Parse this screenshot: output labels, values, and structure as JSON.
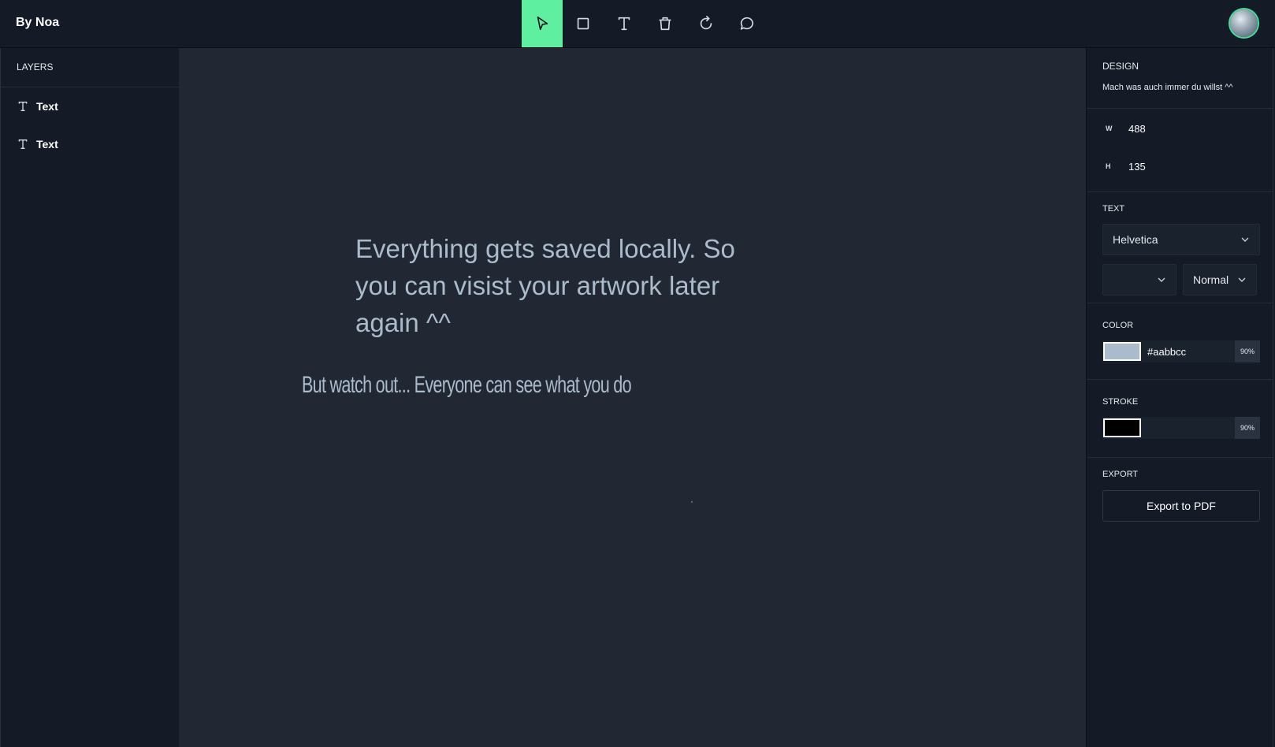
{
  "app": {
    "brand": "By Noa"
  },
  "toolbar": {
    "tools": [
      {
        "name": "select",
        "icon": "cursor-icon",
        "active": true
      },
      {
        "name": "rectangle",
        "icon": "square-icon",
        "active": false
      },
      {
        "name": "text",
        "icon": "text-icon",
        "active": false
      },
      {
        "name": "delete",
        "icon": "trash-icon",
        "active": false
      },
      {
        "name": "reset",
        "icon": "refresh-icon",
        "active": false
      },
      {
        "name": "comment",
        "icon": "chat-bubble-icon",
        "active": false
      }
    ],
    "accent": "#5ef0a0"
  },
  "layers": {
    "title": "LAYERS",
    "items": [
      {
        "label": "Text",
        "icon": "text-icon"
      },
      {
        "label": "Text",
        "icon": "text-icon"
      }
    ]
  },
  "canvas": {
    "text1": "Everything gets saved locally. So you can visist your artwork later again ^^",
    "text2": "But watch out... Everyone can see what you do"
  },
  "design": {
    "title": "DESIGN",
    "subtitle": "Mach was auch immer du willst ^^",
    "width_label": "W",
    "width_value": "488",
    "height_label": "H",
    "height_value": "135",
    "text_title": "TEXT",
    "font_family": "Helvetica",
    "font_size": "",
    "font_weight": "Normal",
    "color_title": "COLOR",
    "color_hex": "#aabbcc",
    "color_opacity": "90%",
    "stroke_title": "STROKE",
    "stroke_color": "#000000",
    "stroke_opacity": "90%",
    "export_title": "EXPORT",
    "export_button": "Export to PDF"
  }
}
